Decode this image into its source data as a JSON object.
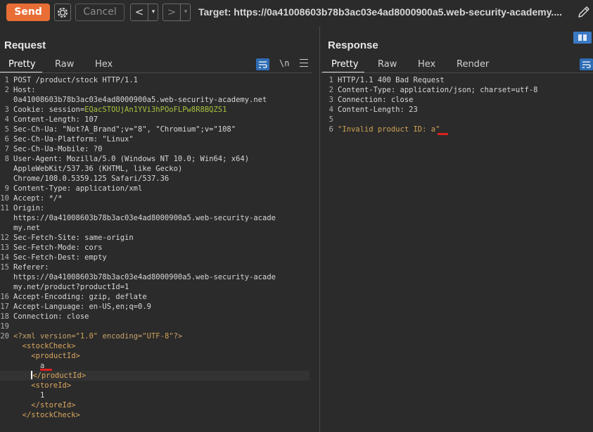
{
  "toolbar": {
    "send_label": "Send",
    "cancel_label": "Cancel",
    "back_arrow": "<",
    "forward_arrow": ">",
    "dropdown_glyph": "▾",
    "target_text": "Target: https://0a41008603b78b3ac03e4ad8000900a5.web-security-academy...."
  },
  "request": {
    "title": "Request",
    "tabs": [
      "Pretty",
      "Raw",
      "Hex"
    ],
    "active_tab": "Pretty",
    "newline_toggle": "\\n",
    "lines": [
      {
        "n": "1",
        "key": "POST /product/stock HTTP/1.1",
        "val": ""
      },
      {
        "n": "2",
        "key": "Host:",
        "val": ""
      },
      {
        "n": "",
        "key": "0a41008603b78b3ac03e4ad8000900a5.web-security-academy.net",
        "val": ""
      },
      {
        "n": "3",
        "key": "Cookie: session=",
        "val": "EQacSTOUjAn1YVi3hPOoFLPw8R8BQZS1"
      },
      {
        "n": "4",
        "key": "Content-Length: 107",
        "val": ""
      },
      {
        "n": "5",
        "key": "Sec-Ch-Ua: \"Not?A_Brand\";v=\"8\", \"Chromium\";v=\"108\"",
        "val": ""
      },
      {
        "n": "6",
        "key": "Sec-Ch-Ua-Platform: \"Linux\"",
        "val": ""
      },
      {
        "n": "7",
        "key": "Sec-Ch-Ua-Mobile: ?0",
        "val": ""
      },
      {
        "n": "8",
        "key": "User-Agent: Mozilla/5.0 (Windows NT 10.0; Win64; x64)",
        "val": ""
      },
      {
        "n": "",
        "key": "AppleWebKit/537.36 (KHTML, like Gecko)",
        "val": ""
      },
      {
        "n": "",
        "key": "Chrome/108.0.5359.125 Safari/537.36",
        "val": ""
      },
      {
        "n": "9",
        "key": "Content-Type: application/xml",
        "val": ""
      },
      {
        "n": "10",
        "key": "Accept: */*",
        "val": ""
      },
      {
        "n": "11",
        "key": "Origin:",
        "val": ""
      },
      {
        "n": "",
        "key": "https://0a41008603b78b3ac03e4ad8000900a5.web-security-acade",
        "val": ""
      },
      {
        "n": "",
        "key": "my.net",
        "val": ""
      },
      {
        "n": "12",
        "key": "Sec-Fetch-Site: same-origin",
        "val": ""
      },
      {
        "n": "13",
        "key": "Sec-Fetch-Mode: cors",
        "val": ""
      },
      {
        "n": "14",
        "key": "Sec-Fetch-Dest: empty",
        "val": ""
      },
      {
        "n": "15",
        "key": "Referer:",
        "val": ""
      },
      {
        "n": "",
        "key": "https://0a41008603b78b3ac03e4ad8000900a5.web-security-acade",
        "val": ""
      },
      {
        "n": "",
        "key": "my.net/product?productId=1",
        "val": ""
      },
      {
        "n": "16",
        "key": "Accept-Encoding: gzip, deflate",
        "val": ""
      },
      {
        "n": "17",
        "key": "Accept-Language: en-US,en;q=0.9",
        "val": ""
      },
      {
        "n": "18",
        "key": "Connection: close",
        "val": ""
      },
      {
        "n": "19",
        "key": "",
        "val": ""
      }
    ],
    "xml": {
      "line_no": "20",
      "decl_open": "<?xml ",
      "decl_attr1": "version=",
      "decl_val1": "\"1.0\"",
      "decl_attr2": " encoding=",
      "decl_val2": "\"UTF-8\"",
      "decl_close": "?>",
      "stock_open": "<stockCheck>",
      "product_open": "<productId>",
      "product_value": "a",
      "product_close_rest": "/productId>",
      "product_close_lt": "<",
      "store_open": "<storeId>",
      "store_value": "1",
      "store_close": "</storeId>",
      "stock_close": "</stockCheck>"
    }
  },
  "response": {
    "title": "Response",
    "tabs": [
      "Pretty",
      "Raw",
      "Hex",
      "Render"
    ],
    "active_tab": "Pretty",
    "lines": [
      {
        "n": "1",
        "text": "HTTP/1.1 400 Bad Request"
      },
      {
        "n": "2",
        "text": "Content-Type: application/json; charset=utf-8"
      },
      {
        "n": "3",
        "text": "Connection: close"
      },
      {
        "n": "4",
        "text": "Content-Length: 23"
      },
      {
        "n": "5",
        "text": ""
      },
      {
        "n": "6",
        "text": "\"Invalid product ID: a\""
      }
    ]
  },
  "colors": {
    "send": "#e86e35",
    "accent_blue": "#3b79c4",
    "cookie_value": "#a6c23e",
    "xml_tag": "#dba75e",
    "error_underline": "#e02020"
  }
}
